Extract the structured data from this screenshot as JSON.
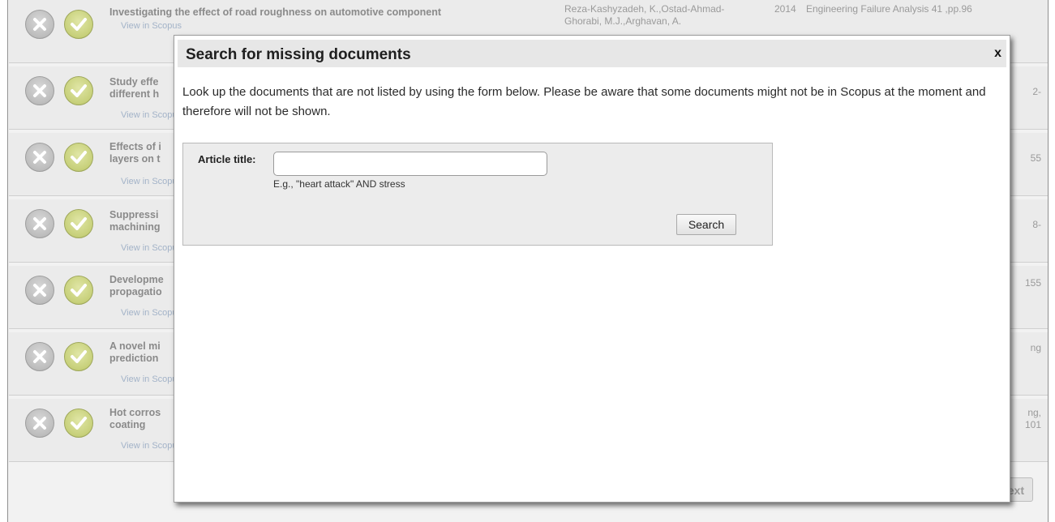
{
  "rows": [
    {
      "title": "Investigating the effect of road roughness on automotive component",
      "link": "View in Scopus",
      "authors": "Reza-Kashyzadeh, K.,Ostad-Ahmad-Ghorabi, M.J.,Arghavan, A.",
      "year": "2014",
      "source": "Engineering Failure Analysis 41 ,pp.96",
      "tail": ""
    },
    {
      "title": "Study effe\ndifferent h",
      "link": "View in Scopus",
      "authors": "",
      "year": "",
      "source": "",
      "tail": "2-"
    },
    {
      "title": "Effects of i\nlayers on t",
      "link": "View in Scopus",
      "authors": "",
      "year": "",
      "source": "",
      "tail": "55"
    },
    {
      "title": "Suppressi\nmachining",
      "link": "View in Scopus",
      "authors": "",
      "year": "",
      "source": "",
      "tail": "8-"
    },
    {
      "title": "Developme\npropagatio",
      "link": "View in Scopus",
      "authors": "",
      "year": "",
      "source": "",
      "tail": "155"
    },
    {
      "title": "A novel mi\nprediction",
      "link": "View in Scopus",
      "authors": "",
      "year": "",
      "source": "",
      "tail": "ng"
    },
    {
      "title": "Hot corros\ncoating",
      "link": "View in Scopus",
      "authors": "",
      "year": "",
      "source": "",
      "tail": "ng,\n101"
    }
  ],
  "pagination": {
    "next_label": "Next"
  },
  "modal": {
    "title": "Search for missing documents",
    "close_label": "x",
    "description": "Look up the documents that are not listed by using the form below. Please be aware that some documents might not be in Scopus at the moment and therefore will not be shown.",
    "form": {
      "label": "Article title:",
      "value": "",
      "placeholder": "",
      "hint": "E.g., \"heart attack\" AND stress",
      "search_label": "Search"
    }
  },
  "colors": {
    "accept": "#c7d07a",
    "reject": "#bdbdbd",
    "link": "#a3b3c8"
  }
}
